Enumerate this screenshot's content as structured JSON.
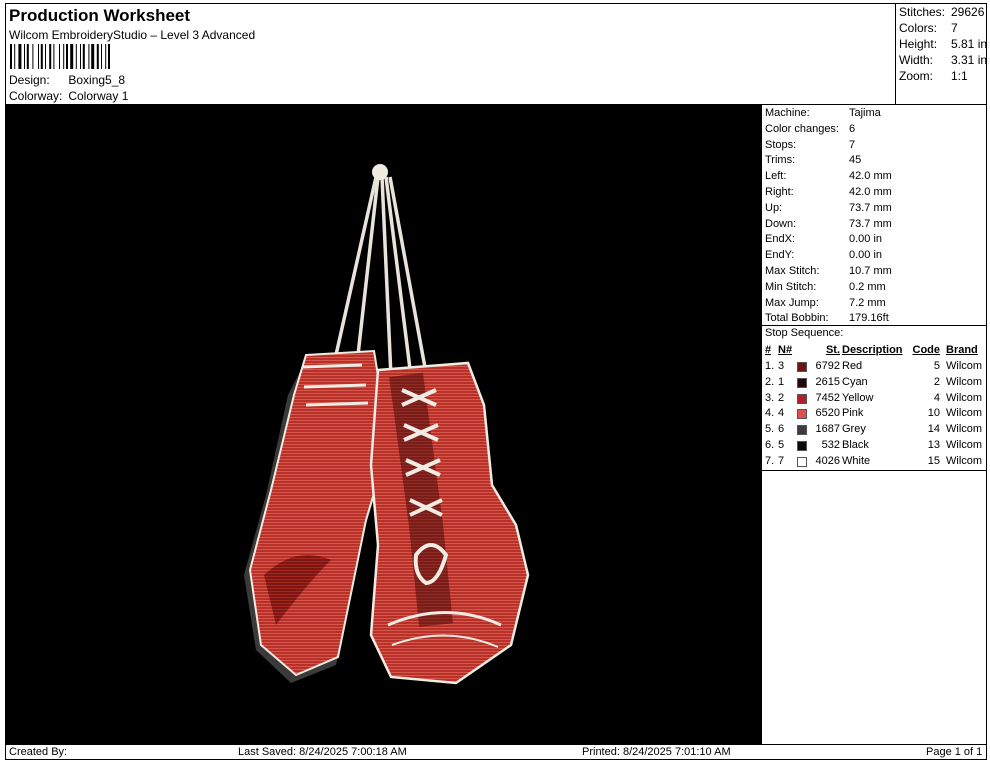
{
  "header": {
    "title": "Production Worksheet",
    "subtitle": "Wilcom EmbroideryStudio – Level 3 Advanced",
    "design_label": "Design:",
    "design_value": "Boxing5_8",
    "colorway_label": "Colorway:",
    "colorway_value": "Colorway 1"
  },
  "stats": [
    {
      "label": "Stitches:",
      "value": "29626"
    },
    {
      "label": "Colors:",
      "value": "7"
    },
    {
      "label": "Height:",
      "value": "5.81 in"
    },
    {
      "label": "Width:",
      "value": "3.31 in"
    },
    {
      "label": "Zoom:",
      "value": "1:1"
    }
  ],
  "machine_info": [
    {
      "label": "Machine:",
      "value": "Tajima"
    },
    {
      "label": "Color changes:",
      "value": "6"
    },
    {
      "label": "Stops:",
      "value": "7"
    },
    {
      "label": "Trims:",
      "value": "45"
    },
    {
      "label": "Left:",
      "value": "42.0 mm"
    },
    {
      "label": "Right:",
      "value": "42.0 mm"
    },
    {
      "label": "Up:",
      "value": "73.7 mm"
    },
    {
      "label": "Down:",
      "value": "73.7 mm"
    },
    {
      "label": "EndX:",
      "value": "0.00 in"
    },
    {
      "label": "EndY:",
      "value": "0.00 in"
    },
    {
      "label": "Max Stitch:",
      "value": "10.7 mm"
    },
    {
      "label": "Min Stitch:",
      "value": "0.2 mm"
    },
    {
      "label": "Max Jump:",
      "value": "7.2 mm"
    },
    {
      "label": "Total Bobbin:",
      "value": "179.16ft"
    }
  ],
  "stop_sequence": {
    "label": "Stop Sequence:",
    "headers": {
      "num": "#",
      "n": "N#",
      "st": "St.",
      "desc": "Description",
      "code": "Code",
      "brand": "Brand"
    },
    "rows": [
      {
        "num": "1.",
        "n": "3",
        "color": "#6e1414",
        "st": "6792",
        "desc": "Red",
        "code": "5",
        "brand": "Wilcom"
      },
      {
        "num": "2.",
        "n": "1",
        "color": "#1e0a0a",
        "st": "2615",
        "desc": "Cyan",
        "code": "2",
        "brand": "Wilcom"
      },
      {
        "num": "3.",
        "n": "2",
        "color": "#b0202a",
        "st": "7452",
        "desc": "Yellow",
        "code": "4",
        "brand": "Wilcom"
      },
      {
        "num": "4.",
        "n": "4",
        "color": "#e05050",
        "st": "6520",
        "desc": "Pink",
        "code": "10",
        "brand": "Wilcom"
      },
      {
        "num": "5.",
        "n": "6",
        "color": "#3c3c3c",
        "st": "1687",
        "desc": "Grey",
        "code": "14",
        "brand": "Wilcom"
      },
      {
        "num": "6.",
        "n": "5",
        "color": "#0a0a0a",
        "st": "532",
        "desc": "Black",
        "code": "13",
        "brand": "Wilcom"
      },
      {
        "num": "7.",
        "n": "7",
        "color": "#ffffff",
        "st": "4026",
        "desc": "White",
        "code": "15",
        "brand": "Wilcom"
      }
    ]
  },
  "footer": {
    "created_by": "Created By:",
    "last_saved": "Last Saved: 8/24/2025 7:00:18 AM",
    "printed": "Printed: 8/24/2025 7:01:10 AM",
    "page": "Page 1 of 1"
  }
}
